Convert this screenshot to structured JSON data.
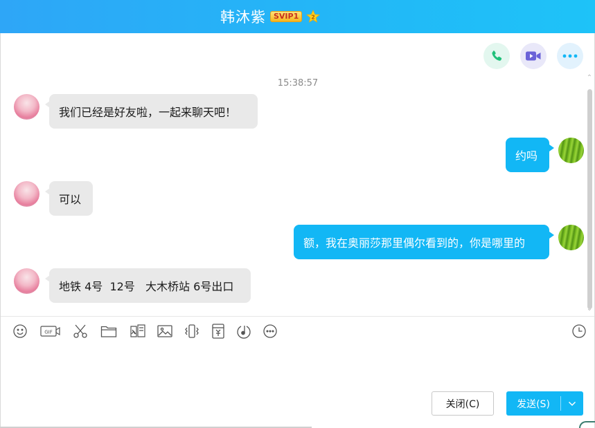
{
  "window": {
    "contact_name": "韩沐紫",
    "vip_badge": "SVIP1",
    "accent_color": "#12b7f5",
    "title_gradient": [
      "#2ea6f7",
      "#1ec3f8"
    ]
  },
  "call_actions": [
    {
      "name": "phone-icon",
      "color": "#20c07a"
    },
    {
      "name": "video-camera-icon",
      "color": "#6b63d8"
    },
    {
      "name": "more-icon",
      "color": "#12b7f5"
    }
  ],
  "chat": {
    "timestamp": "15:38:57",
    "messages": [
      {
        "from": "contact",
        "text": "我们已经是好友啦，一起来聊天吧！"
      },
      {
        "from": "self",
        "text": "约吗"
      },
      {
        "from": "contact",
        "text": "可以"
      },
      {
        "from": "self",
        "text": "额，我在奥丽莎那里偶尔看到的，你是哪里的"
      },
      {
        "from": "contact",
        "text": "地铁 4号  12号   大木桥站 6号出口"
      }
    ]
  },
  "toolbar": {
    "icons": [
      "smiley-icon",
      "gif-icon",
      "scissors-icon",
      "folder-icon",
      "image-edit-icon",
      "image-icon",
      "shake-icon",
      "red-packet-icon",
      "music-icon",
      "more-icon",
      "history-clock-icon"
    ]
  },
  "footer": {
    "close_label": "关闭(C)",
    "send_label": "发送(S)"
  }
}
